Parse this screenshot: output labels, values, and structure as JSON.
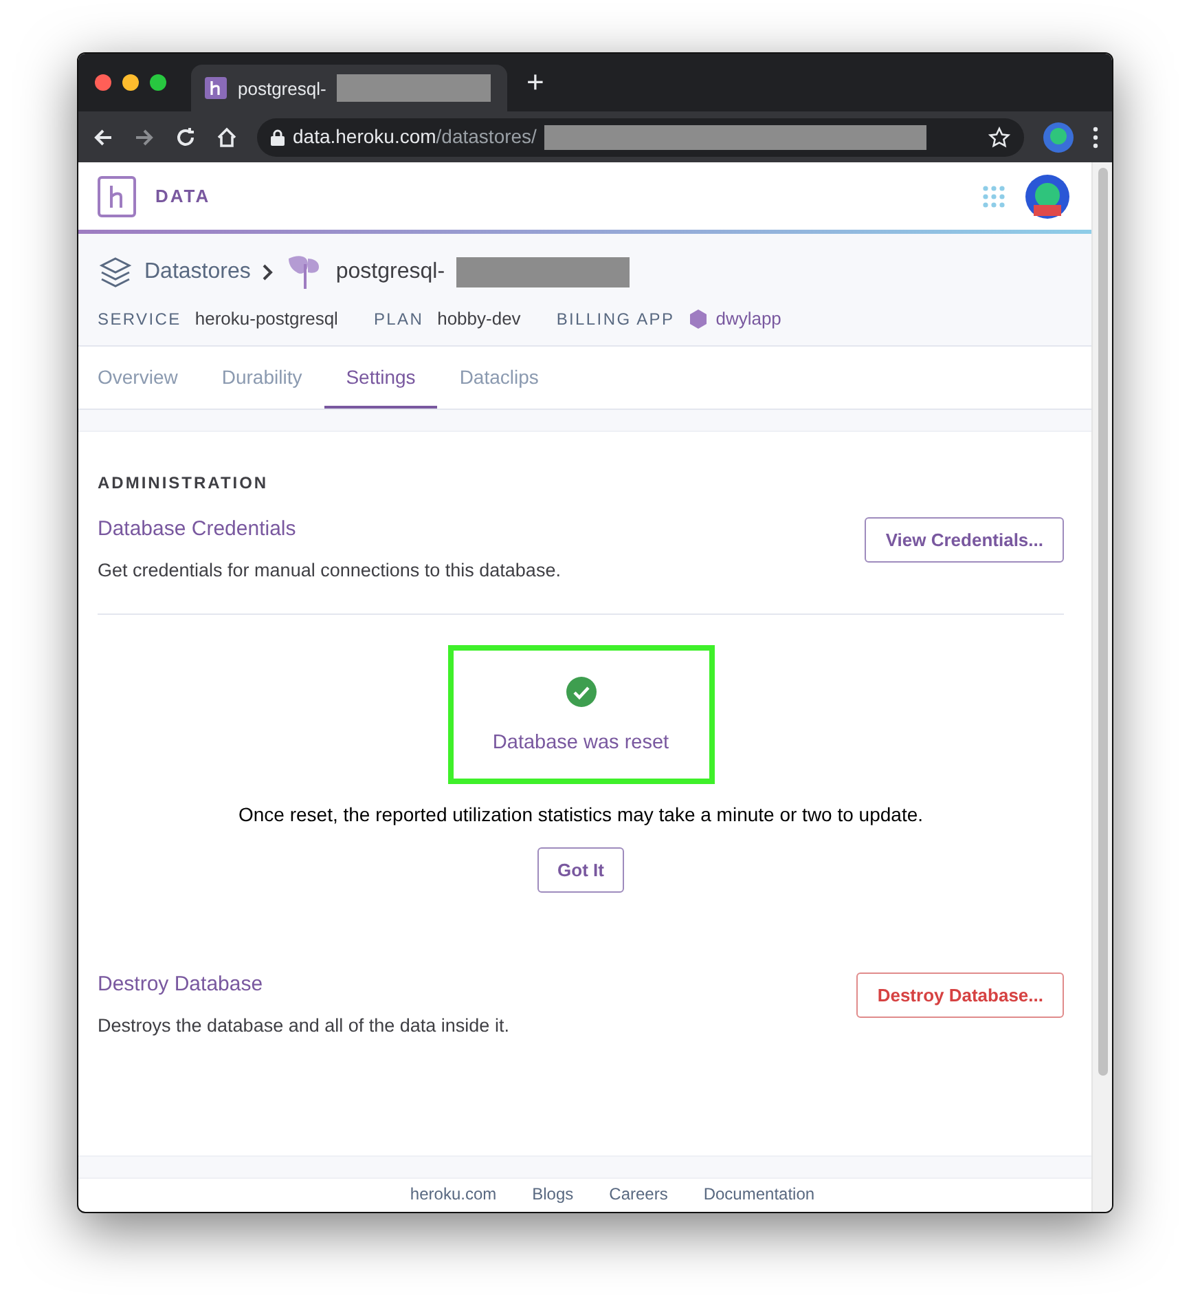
{
  "browser": {
    "tab_title": "postgresql-",
    "new_tab": "+",
    "url_host": "data.heroku.com",
    "url_path": "/datastores/"
  },
  "header": {
    "brand": "DATA"
  },
  "breadcrumb": {
    "parent": "Datastores",
    "current": "postgresql-"
  },
  "meta": [
    {
      "label": "SERVICE",
      "value": "heroku-postgresql",
      "kind": "text"
    },
    {
      "label": "PLAN",
      "value": "hobby-dev",
      "kind": "text"
    },
    {
      "label": "BILLING APP",
      "value": "dwylapp",
      "kind": "link"
    }
  ],
  "tabs": [
    {
      "label": "Overview",
      "selected": false
    },
    {
      "label": "Durability",
      "selected": false
    },
    {
      "label": "Settings",
      "selected": true
    },
    {
      "label": "Dataclips",
      "selected": false
    }
  ],
  "section_title": "ADMINISTRATION",
  "credentials": {
    "title": "Database Credentials",
    "description": "Get credentials for manual connections to this database.",
    "button": "View Credentials..."
  },
  "reset_notice": {
    "title": "Database was reset",
    "message": "Once reset, the reported utilization statistics may take a minute or two to update.",
    "button": "Got It",
    "highlighted": true
  },
  "destroy": {
    "title": "Destroy Database",
    "description": "Destroys the database and all of the data inside it.",
    "button": "Destroy Database..."
  },
  "footer_links": [
    "heroku.com",
    "Blogs",
    "Careers",
    "Documentation"
  ]
}
